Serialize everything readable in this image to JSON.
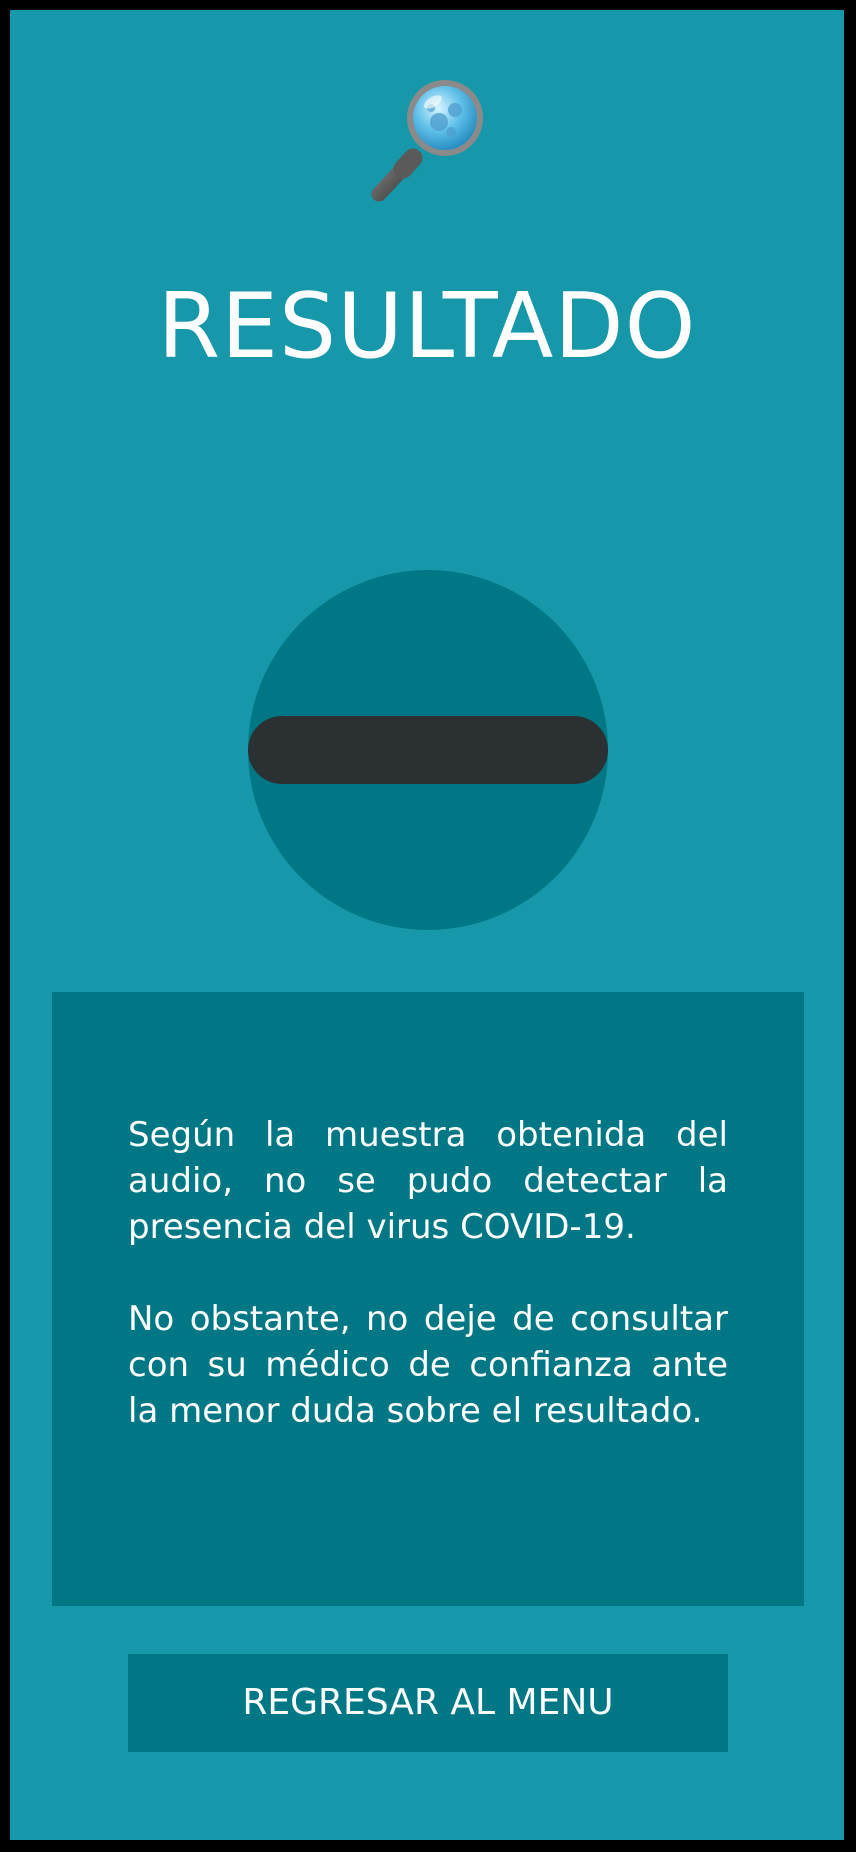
{
  "screen": {
    "title": "RESULTADO",
    "header_icon": "magnifier-virus-icon",
    "result_icon": "negative-minus-icon"
  },
  "message": {
    "paragraph_1": "Según la muestra obtenida del audio, no se pudo detectar la presencia del virus COVID-19.",
    "paragraph_2": "No obstante, no deje de consultar con su médico de confianza ante la menor duda sobre el resultado."
  },
  "actions": {
    "back_label": "REGRESAR AL MENU"
  },
  "colors": {
    "background": "#1698aa",
    "panel": "#007784",
    "minus_bar": "#2b3033",
    "text": "#ffffff",
    "frame": "#000000"
  }
}
